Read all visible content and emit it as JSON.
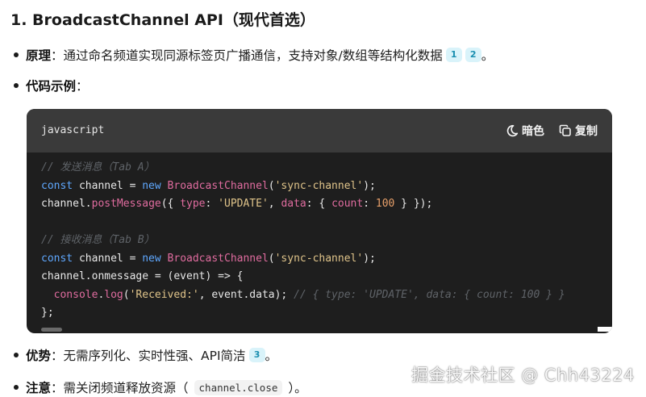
{
  "heading": "1. BroadcastChannel API（现代首选）",
  "bullets": {
    "principle": {
      "label": "原理",
      "text": "：通过命名频道实现同源标签页广播通信，支持对象/数组等结构化数据",
      "refs": [
        "1",
        "2"
      ],
      "suffix": "。"
    },
    "example": {
      "label": "代码示例",
      "text": "："
    },
    "advantage": {
      "label": "优势",
      "text": "：无需序列化、实时性强、API简洁",
      "refs": [
        "3"
      ],
      "suffix": "。"
    },
    "note": {
      "label": "注意",
      "text": "：需关闭频道释放资源（",
      "code": "channel.close",
      "suffix": "）。"
    }
  },
  "code_block": {
    "language": "javascript",
    "theme_label": "暗色",
    "copy_label": "复制",
    "theme_icon": "moon-icon",
    "copy_icon": "copy-icon",
    "lines": [
      [
        {
          "t": "// 发送消息（Tab A）",
          "k": "comment"
        }
      ],
      [
        {
          "t": "const",
          "k": "kw"
        },
        {
          "t": " channel = ",
          "k": "plain"
        },
        {
          "t": "new",
          "k": "kw"
        },
        {
          "t": " ",
          "k": "plain"
        },
        {
          "t": "BroadcastChannel",
          "k": "cls"
        },
        {
          "t": "(",
          "k": "plain"
        },
        {
          "t": "'sync-channel'",
          "k": "str"
        },
        {
          "t": ");",
          "k": "plain"
        }
      ],
      [
        {
          "t": "channel.",
          "k": "plain"
        },
        {
          "t": "postMessage",
          "k": "fn"
        },
        {
          "t": "({ ",
          "k": "plain"
        },
        {
          "t": "type",
          "k": "prop"
        },
        {
          "t": ": ",
          "k": "plain"
        },
        {
          "t": "'UPDATE'",
          "k": "str"
        },
        {
          "t": ", ",
          "k": "plain"
        },
        {
          "t": "data",
          "k": "prop"
        },
        {
          "t": ": { ",
          "k": "plain"
        },
        {
          "t": "count",
          "k": "prop"
        },
        {
          "t": ": ",
          "k": "plain"
        },
        {
          "t": "100",
          "k": "num"
        },
        {
          "t": " } });",
          "k": "plain"
        }
      ],
      [
        {
          "t": "",
          "k": "plain"
        }
      ],
      [
        {
          "t": "// 接收消息（Tab B）",
          "k": "comment"
        }
      ],
      [
        {
          "t": "const",
          "k": "kw"
        },
        {
          "t": " channel = ",
          "k": "plain"
        },
        {
          "t": "new",
          "k": "kw"
        },
        {
          "t": " ",
          "k": "plain"
        },
        {
          "t": "BroadcastChannel",
          "k": "cls"
        },
        {
          "t": "(",
          "k": "plain"
        },
        {
          "t": "'sync-channel'",
          "k": "str"
        },
        {
          "t": ");",
          "k": "plain"
        }
      ],
      [
        {
          "t": "channel.onmessage = (event) => {",
          "k": "plain"
        }
      ],
      [
        {
          "t": "  ",
          "k": "plain"
        },
        {
          "t": "console",
          "k": "cls"
        },
        {
          "t": ".",
          "k": "plain"
        },
        {
          "t": "log",
          "k": "fn"
        },
        {
          "t": "(",
          "k": "plain"
        },
        {
          "t": "'Received:'",
          "k": "str"
        },
        {
          "t": ", event.data); ",
          "k": "plain"
        },
        {
          "t": "// { type: 'UPDATE', data: { count: 100 } }",
          "k": "comment"
        }
      ],
      [
        {
          "t": "};",
          "k": "plain"
        }
      ]
    ]
  },
  "watermark": "掘金技术社区 @ Chh43224"
}
